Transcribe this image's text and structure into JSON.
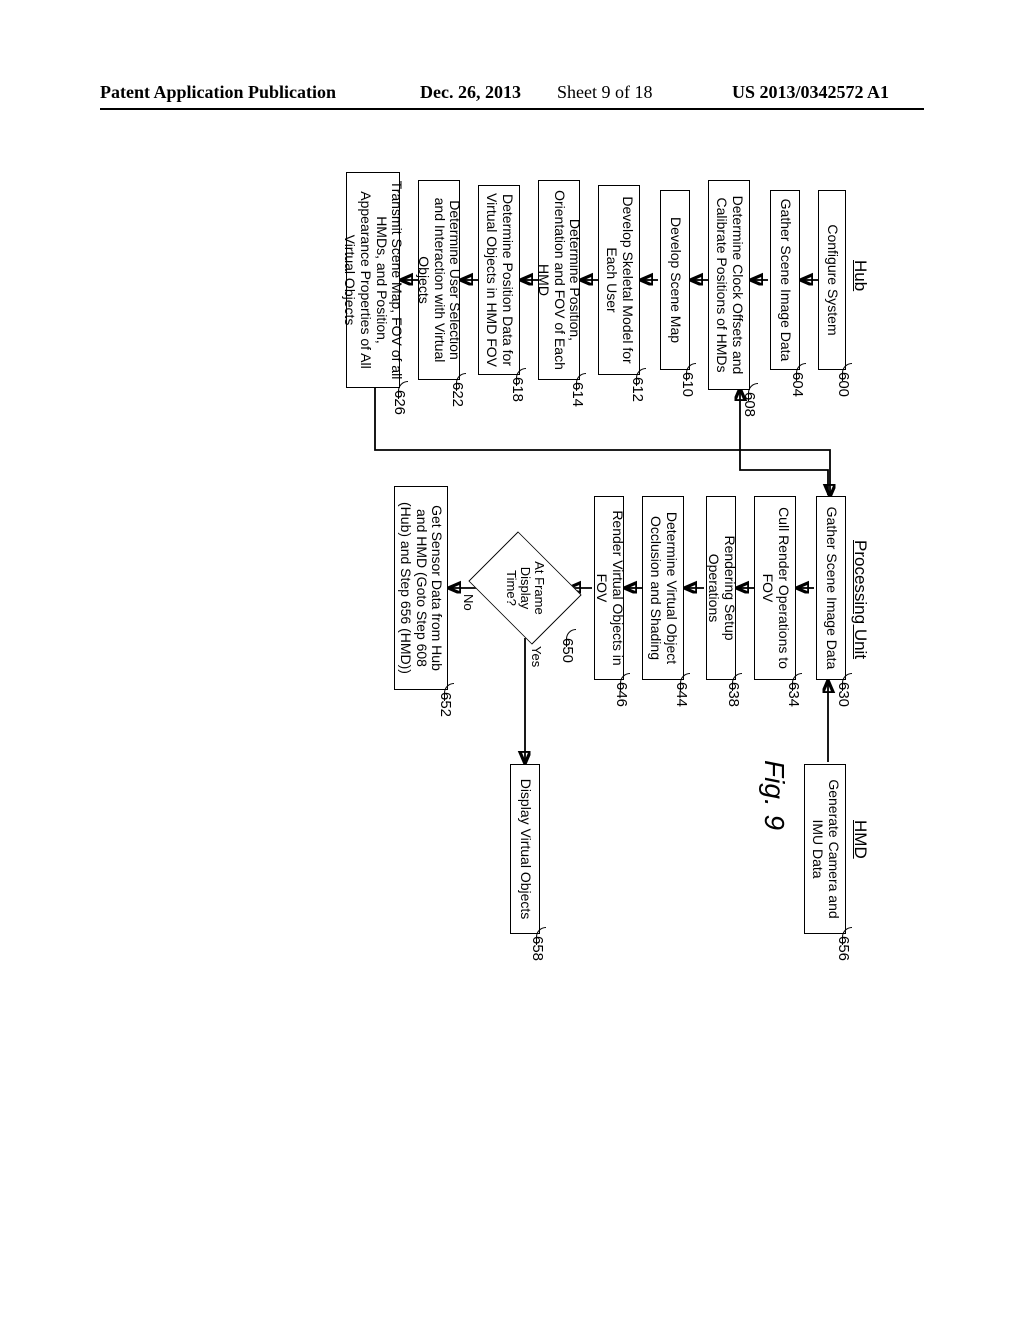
{
  "header": {
    "left": "Patent Application Publication",
    "date": "Dec. 26, 2013",
    "sheet": "Sheet 9 of 18",
    "pubno": "US 2013/0342572 A1"
  },
  "figure_label": "Fig. 9",
  "columns": {
    "hub": "Hub",
    "pu": "Processing Unit",
    "hmd": "HMD"
  },
  "hub": {
    "r600": "600",
    "b600": "Configure System",
    "r604": "604",
    "b604": "Gather Scene Image Data",
    "r608": "608",
    "b608": "Determine Clock Offsets and Calibrate Positions of HMDs",
    "r610": "610",
    "b610": "Develop Scene Map",
    "r612": "612",
    "b612": "Develop Skeletal Model for Each User",
    "r614": "614",
    "b614": "Determine Position, Orientation and FOV of Each HMD",
    "r618": "618",
    "b618": "Determine Position Data for Virtual Objects in HMD FOV",
    "r622": "622",
    "b622": "Determine User Selection and Interaction with Virtual Objects",
    "r626": "626",
    "b626": "Transmit Scene Map, FOV of all HMDs, and Position, Appearance Properties of All Virtual Objects"
  },
  "pu": {
    "r630": "630",
    "b630": "Gather Scene Image Data",
    "r634": "634",
    "b634": "Cull Render Operations to FOV",
    "r638": "638",
    "b638": "Rendering Setup Operations",
    "r644": "644",
    "b644": "Determine Virtual Object Occlusion and Shading",
    "r646": "646",
    "b646": "Render Virtual Objects in FOV",
    "r650": "650",
    "d650": "At Frame Display Time?",
    "yes": "Yes",
    "no": "No",
    "r652": "652",
    "b652": "Get Sensor Data from Hub and HMD (Goto Step 608 (Hub) and Step 656 (HMD))"
  },
  "hmd": {
    "r656": "656",
    "b656": "Generate Camera and IMU Data",
    "r658": "658",
    "b658": "Display Virtual Objects"
  }
}
